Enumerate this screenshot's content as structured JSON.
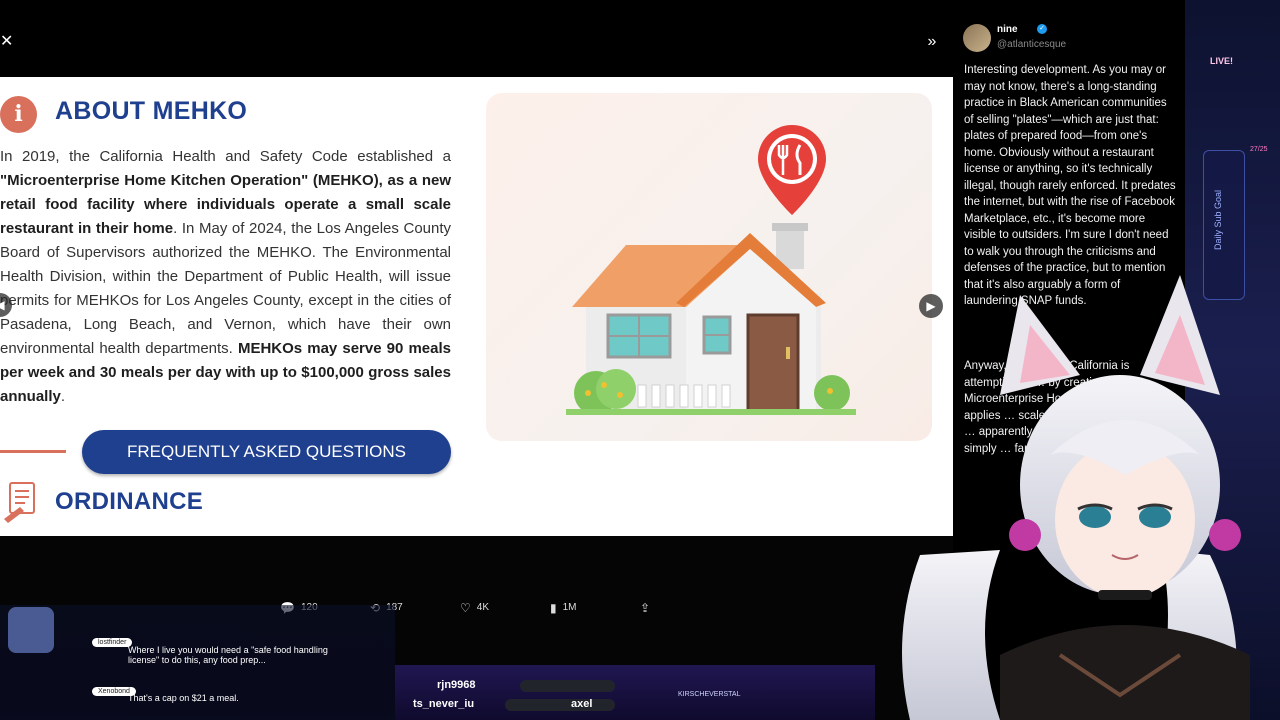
{
  "lightbox": {
    "close_icon": "✕",
    "expand_icon": "»"
  },
  "panel": {
    "about_icon": "i",
    "about_title": "ABOUT MEHKO",
    "body_html_parts": {
      "p1": "In 2019, the California Health and Safety Code established a ",
      "b1": "\"Microenterprise Home Kitchen Operation\" (MEHKO), as a new retail food facility where individuals operate a small scale restaurant in their home",
      "p2": ". In May of 2024, the Los Angeles County Board of Supervisors authorized the MEHKO. The Environmental Health Division, within the Department of Public Health, will issue permits for MEHKOs for Los Angeles County, except in the cities of Pasadena, Long Beach, and Vernon, which have their own environmental health departments. ",
      "b2": "MEHKOs may serve 90 meals per week and 30 meals per day with up to $100,000 gross sales annually",
      "p3": "."
    },
    "faq_button": "FREQUENTLY ASKED QUESTIONS",
    "ordinance_title": "ORDINANCE",
    "prev_arrow": "◀",
    "next_arrow": "▶"
  },
  "stats": {
    "replies": "120",
    "reposts": "187",
    "likes": "4K",
    "views": "1M"
  },
  "tweet": {
    "author": "nine",
    "handle": "@atlanticesque",
    "text1": "Interesting development. As you may or may not know, there's a long-standing practice in Black American communities of selling \"plates\"—which are just that: plates of prepared food—from one's home. Obviously without a restaurant license or anything, so it's technically illegal, though rarely enforced. It predates the internet, but with the rise of Facebook Marketplace, etc., it's become more visible to outsiders. I'm sure I don't need to walk you through the criticisms and defenses of the practice, but to mention that it's also arguably a form of laundering SNAP funds.",
    "text2": "Anyway, it looks like California is attempting to … by creating a Microenterprise Home Kitchen … which applies … scale, home … They're even … apparently … otherwise … \"plates\" … simply … far … away."
  },
  "stream": {
    "live_label": "LIVE!",
    "goal_label": "Daily Sub Goal",
    "goal_count": "27/25",
    "chat": [
      {
        "user": "lostfinder",
        "msg": "Where I live you would need a \"safe food handling license\" to do this, any food prep..."
      },
      {
        "user": "Xenobond",
        "msg": "That's a cap on $21 a meal."
      }
    ],
    "ticker": {
      "name1": "rjn9968",
      "name2": "ts_never_iu",
      "name3": "axel",
      "tag": "KIRSCHEVERSTAL"
    }
  },
  "colors": {
    "accent_blue": "#1f3f8f",
    "accent_orange": "#d9705c"
  }
}
